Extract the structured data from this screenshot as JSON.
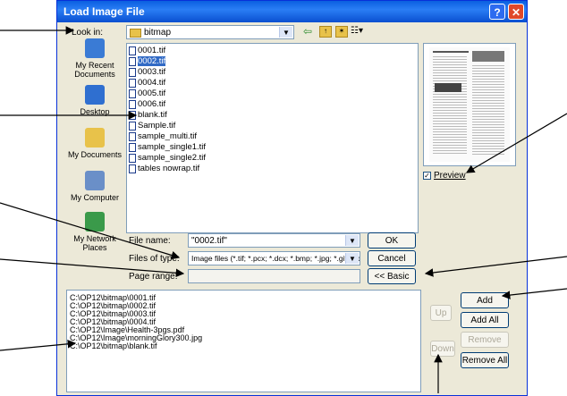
{
  "window": {
    "title": "Load Image File",
    "help_glyph": "?",
    "close_glyph": "✕"
  },
  "lookin": {
    "label": "Look in:",
    "value": "bitmap"
  },
  "places": [
    {
      "label": "My Recent Documents",
      "icon": "recent-documents-icon",
      "color": "#3a7bd5"
    },
    {
      "label": "Desktop",
      "icon": "desktop-icon",
      "color": "#2f6fd0"
    },
    {
      "label": "My Documents",
      "icon": "my-documents-icon",
      "color": "#e8c24a"
    },
    {
      "label": "My Computer",
      "icon": "my-computer-icon",
      "color": "#6a8fc8"
    },
    {
      "label": "My Network Places",
      "icon": "network-places-icon",
      "color": "#3a9a4a"
    }
  ],
  "files": [
    {
      "name": "0001.tif",
      "selected": false
    },
    {
      "name": "0002.tif",
      "selected": true
    },
    {
      "name": "0003.tif",
      "selected": false
    },
    {
      "name": "0004.tif",
      "selected": false
    },
    {
      "name": "0005.tif",
      "selected": false
    },
    {
      "name": "0006.tif",
      "selected": false
    },
    {
      "name": "blank.tif",
      "selected": false
    },
    {
      "name": "Sample.tif",
      "selected": false
    },
    {
      "name": "sample_multi.tif",
      "selected": false
    },
    {
      "name": "sample_single1.tif",
      "selected": false
    },
    {
      "name": "sample_single2.tif",
      "selected": false
    },
    {
      "name": "tables nowrap.tif",
      "selected": false
    }
  ],
  "preview": {
    "label": "Preview",
    "checked": true
  },
  "form": {
    "filename_label": "File name:",
    "filename_value": "\"0002.tif\"",
    "filetype_label": "Files of type:",
    "filetype_value": "Image files (*.tif; *.pcx; *.dcx; *.bmp; *.jpg; *.gif; *.pdf)",
    "pagerange_label": "Page range:",
    "pagerange_value": ""
  },
  "buttons": {
    "ok": "OK",
    "cancel": "Cancel",
    "basic": "<< Basic",
    "up": "Up",
    "down": "Down",
    "add": "Add",
    "add_all": "Add All",
    "remove": "Remove",
    "remove_all": "Remove All"
  },
  "selected_files": [
    "C:\\OP12\\bitmap\\0001.tif",
    "C:\\OP12\\bitmap\\0002.tif",
    "C:\\OP12\\bitmap\\0003.tif",
    "C:\\OP12\\bitmap\\0004.tif",
    "C:\\OP12\\Image\\Health-3pgs.pdf",
    "C:\\OP12\\Image\\morningGlory300.jpg",
    "C:\\OP12\\bitmap\\blank.tif"
  ]
}
